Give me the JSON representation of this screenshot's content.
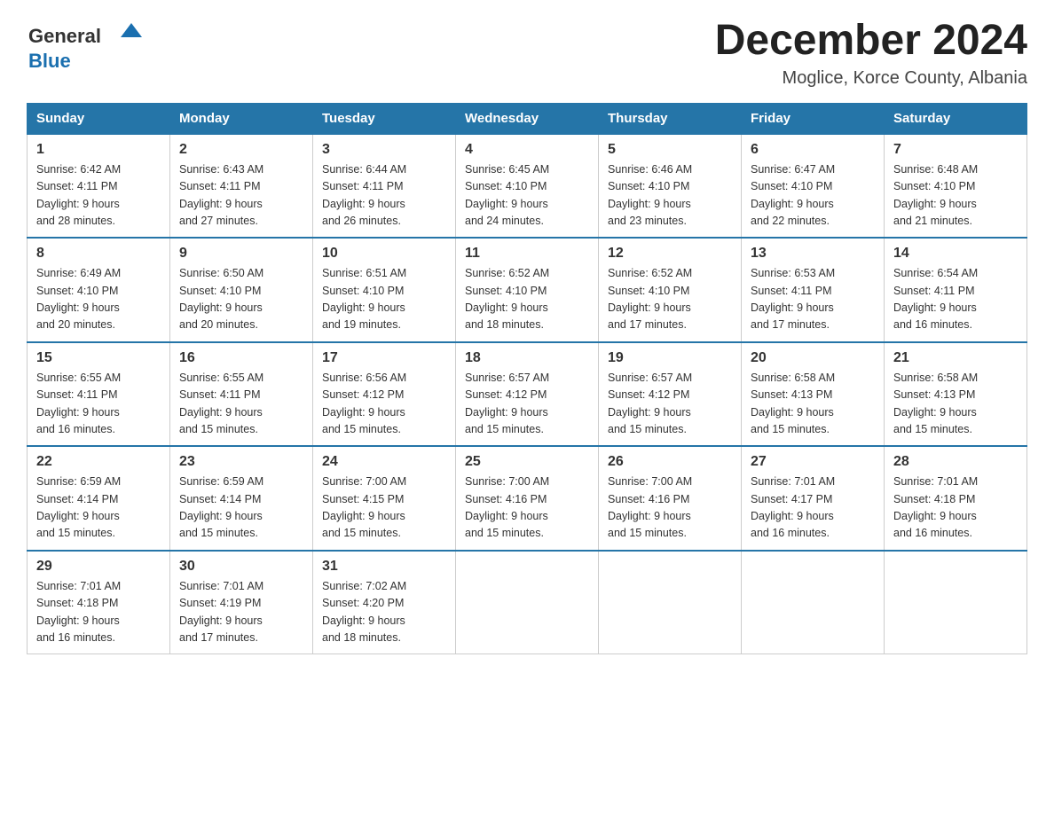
{
  "header": {
    "logo_general": "General",
    "logo_blue": "Blue",
    "month_title": "December 2024",
    "location": "Moglice, Korce County, Albania"
  },
  "days_of_week": [
    "Sunday",
    "Monday",
    "Tuesday",
    "Wednesday",
    "Thursday",
    "Friday",
    "Saturday"
  ],
  "weeks": [
    [
      {
        "day": "1",
        "sunrise": "6:42 AM",
        "sunset": "4:11 PM",
        "daylight": "9 hours and 28 minutes."
      },
      {
        "day": "2",
        "sunrise": "6:43 AM",
        "sunset": "4:11 PM",
        "daylight": "9 hours and 27 minutes."
      },
      {
        "day": "3",
        "sunrise": "6:44 AM",
        "sunset": "4:11 PM",
        "daylight": "9 hours and 26 minutes."
      },
      {
        "day": "4",
        "sunrise": "6:45 AM",
        "sunset": "4:10 PM",
        "daylight": "9 hours and 24 minutes."
      },
      {
        "day": "5",
        "sunrise": "6:46 AM",
        "sunset": "4:10 PM",
        "daylight": "9 hours and 23 minutes."
      },
      {
        "day": "6",
        "sunrise": "6:47 AM",
        "sunset": "4:10 PM",
        "daylight": "9 hours and 22 minutes."
      },
      {
        "day": "7",
        "sunrise": "6:48 AM",
        "sunset": "4:10 PM",
        "daylight": "9 hours and 21 minutes."
      }
    ],
    [
      {
        "day": "8",
        "sunrise": "6:49 AM",
        "sunset": "4:10 PM",
        "daylight": "9 hours and 20 minutes."
      },
      {
        "day": "9",
        "sunrise": "6:50 AM",
        "sunset": "4:10 PM",
        "daylight": "9 hours and 20 minutes."
      },
      {
        "day": "10",
        "sunrise": "6:51 AM",
        "sunset": "4:10 PM",
        "daylight": "9 hours and 19 minutes."
      },
      {
        "day": "11",
        "sunrise": "6:52 AM",
        "sunset": "4:10 PM",
        "daylight": "9 hours and 18 minutes."
      },
      {
        "day": "12",
        "sunrise": "6:52 AM",
        "sunset": "4:10 PM",
        "daylight": "9 hours and 17 minutes."
      },
      {
        "day": "13",
        "sunrise": "6:53 AM",
        "sunset": "4:11 PM",
        "daylight": "9 hours and 17 minutes."
      },
      {
        "day": "14",
        "sunrise": "6:54 AM",
        "sunset": "4:11 PM",
        "daylight": "9 hours and 16 minutes."
      }
    ],
    [
      {
        "day": "15",
        "sunrise": "6:55 AM",
        "sunset": "4:11 PM",
        "daylight": "9 hours and 16 minutes."
      },
      {
        "day": "16",
        "sunrise": "6:55 AM",
        "sunset": "4:11 PM",
        "daylight": "9 hours and 15 minutes."
      },
      {
        "day": "17",
        "sunrise": "6:56 AM",
        "sunset": "4:12 PM",
        "daylight": "9 hours and 15 minutes."
      },
      {
        "day": "18",
        "sunrise": "6:57 AM",
        "sunset": "4:12 PM",
        "daylight": "9 hours and 15 minutes."
      },
      {
        "day": "19",
        "sunrise": "6:57 AM",
        "sunset": "4:12 PM",
        "daylight": "9 hours and 15 minutes."
      },
      {
        "day": "20",
        "sunrise": "6:58 AM",
        "sunset": "4:13 PM",
        "daylight": "9 hours and 15 minutes."
      },
      {
        "day": "21",
        "sunrise": "6:58 AM",
        "sunset": "4:13 PM",
        "daylight": "9 hours and 15 minutes."
      }
    ],
    [
      {
        "day": "22",
        "sunrise": "6:59 AM",
        "sunset": "4:14 PM",
        "daylight": "9 hours and 15 minutes."
      },
      {
        "day": "23",
        "sunrise": "6:59 AM",
        "sunset": "4:14 PM",
        "daylight": "9 hours and 15 minutes."
      },
      {
        "day": "24",
        "sunrise": "7:00 AM",
        "sunset": "4:15 PM",
        "daylight": "9 hours and 15 minutes."
      },
      {
        "day": "25",
        "sunrise": "7:00 AM",
        "sunset": "4:16 PM",
        "daylight": "9 hours and 15 minutes."
      },
      {
        "day": "26",
        "sunrise": "7:00 AM",
        "sunset": "4:16 PM",
        "daylight": "9 hours and 15 minutes."
      },
      {
        "day": "27",
        "sunrise": "7:01 AM",
        "sunset": "4:17 PM",
        "daylight": "9 hours and 16 minutes."
      },
      {
        "day": "28",
        "sunrise": "7:01 AM",
        "sunset": "4:18 PM",
        "daylight": "9 hours and 16 minutes."
      }
    ],
    [
      {
        "day": "29",
        "sunrise": "7:01 AM",
        "sunset": "4:18 PM",
        "daylight": "9 hours and 16 minutes."
      },
      {
        "day": "30",
        "sunrise": "7:01 AM",
        "sunset": "4:19 PM",
        "daylight": "9 hours and 17 minutes."
      },
      {
        "day": "31",
        "sunrise": "7:02 AM",
        "sunset": "4:20 PM",
        "daylight": "9 hours and 18 minutes."
      },
      null,
      null,
      null,
      null
    ]
  ],
  "labels": {
    "sunrise": "Sunrise:",
    "sunset": "Sunset:",
    "daylight": "Daylight:"
  }
}
